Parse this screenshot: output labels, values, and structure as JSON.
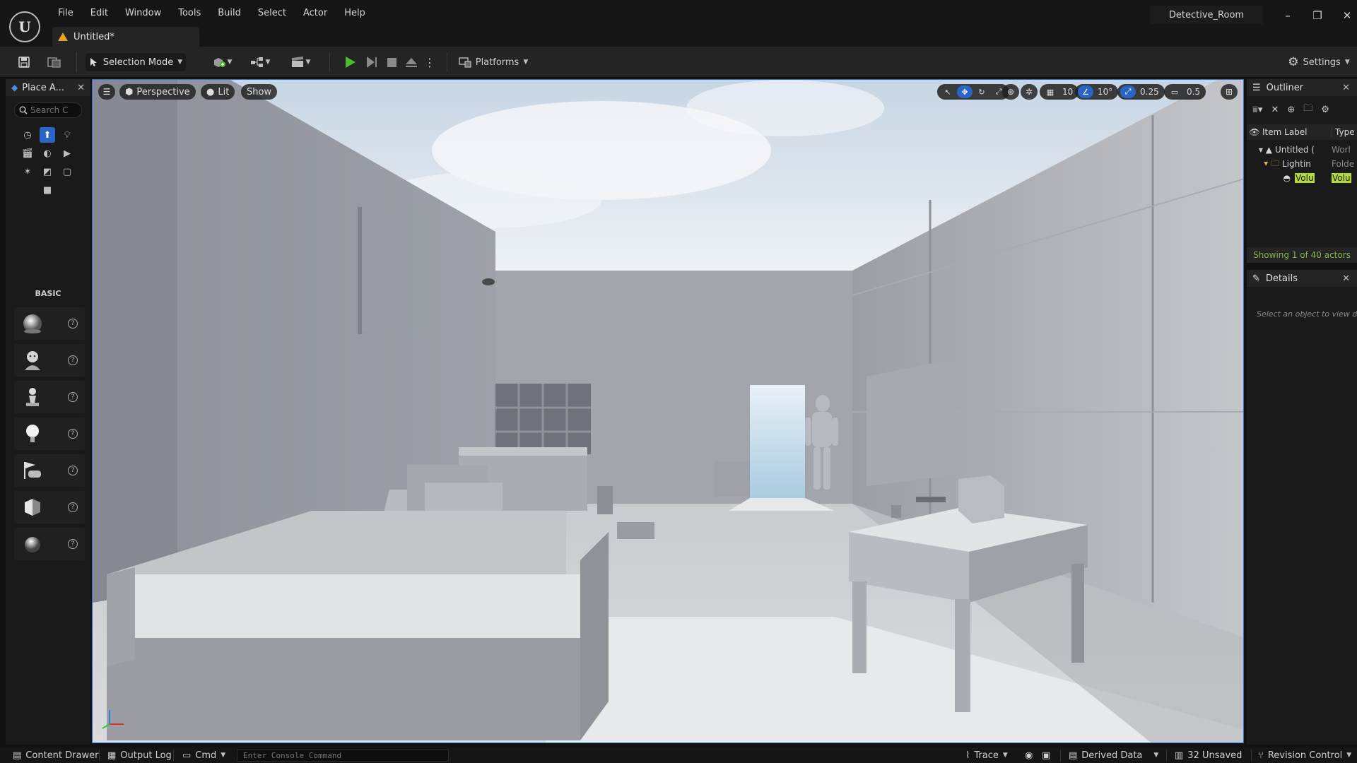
{
  "app": {
    "project_name": "Detective_Room",
    "document_tab": "Untitled*"
  },
  "menu": [
    "File",
    "Edit",
    "Window",
    "Tools",
    "Build",
    "Select",
    "Actor",
    "Help"
  ],
  "toolbar": {
    "mode_label": "Selection Mode",
    "platforms_label": "Platforms",
    "settings_label": "Settings"
  },
  "place_actors": {
    "tab_label": "Place A...",
    "search_placeholder": "Search C",
    "section_label": "BASIC"
  },
  "viewport": {
    "perspective_label": "Perspective",
    "lit_label": "Lit",
    "show_label": "Show",
    "grid_snap": "10",
    "rotation_snap": "10°",
    "scale_snap": "0.25",
    "camera_speed": "0.5"
  },
  "outliner": {
    "tab_label": "Outliner",
    "col_label": "Item Label",
    "col_type": "Type",
    "rows": [
      {
        "label": "Untitled (",
        "type": "Worl"
      },
      {
        "label": "Lightin",
        "type": "Folde"
      },
      {
        "label": "Volu",
        "type": "Volu"
      }
    ],
    "footer": "Showing 1 of 40 actors"
  },
  "details": {
    "tab_label": "Details",
    "empty_text": "Select an object to view deta"
  },
  "statusbar": {
    "content_drawer": "Content Drawer",
    "output_log": "Output Log",
    "cmd": "Cmd",
    "console_placeholder": "Enter Console Command",
    "trace": "Trace",
    "derived_data": "Derived Data",
    "unsaved": "32 Unsaved",
    "revision_control": "Revision Control"
  },
  "colors": {
    "accent": "#2a64c4",
    "play": "#4cbb2c",
    "warning": "#e3a322",
    "outliner_status": "#7fb547"
  }
}
